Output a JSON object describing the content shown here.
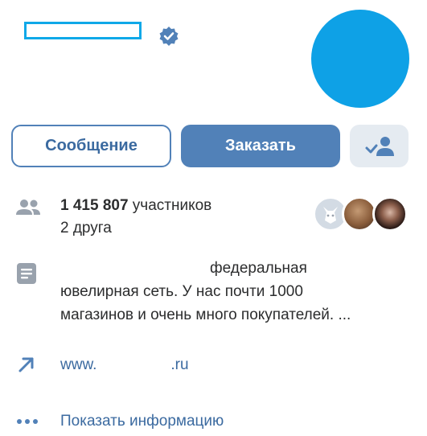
{
  "header": {
    "name_redacted": true,
    "verified_icon": "verified-check-icon",
    "avatar_color": "#0ea1e6"
  },
  "buttons": {
    "message_label": "Сообщение",
    "order_label": "Заказать",
    "friends_icon": "person-check-icon"
  },
  "stats": {
    "members_count": "1 415 807",
    "members_label": " участников",
    "friends_text": "2 друга"
  },
  "description": {
    "line1": "федеральная",
    "line2": "ювелирная сеть. У нас почти 1000",
    "line3": "магазинов и очень много покупателей. ..."
  },
  "website": {
    "prefix": "www.",
    "suffix": ".ru"
  },
  "more": {
    "label": "Показать информацию"
  },
  "colors": {
    "accent": "#5181b8",
    "link": "#3b6aa0",
    "icon_gray": "#99a2ad"
  }
}
